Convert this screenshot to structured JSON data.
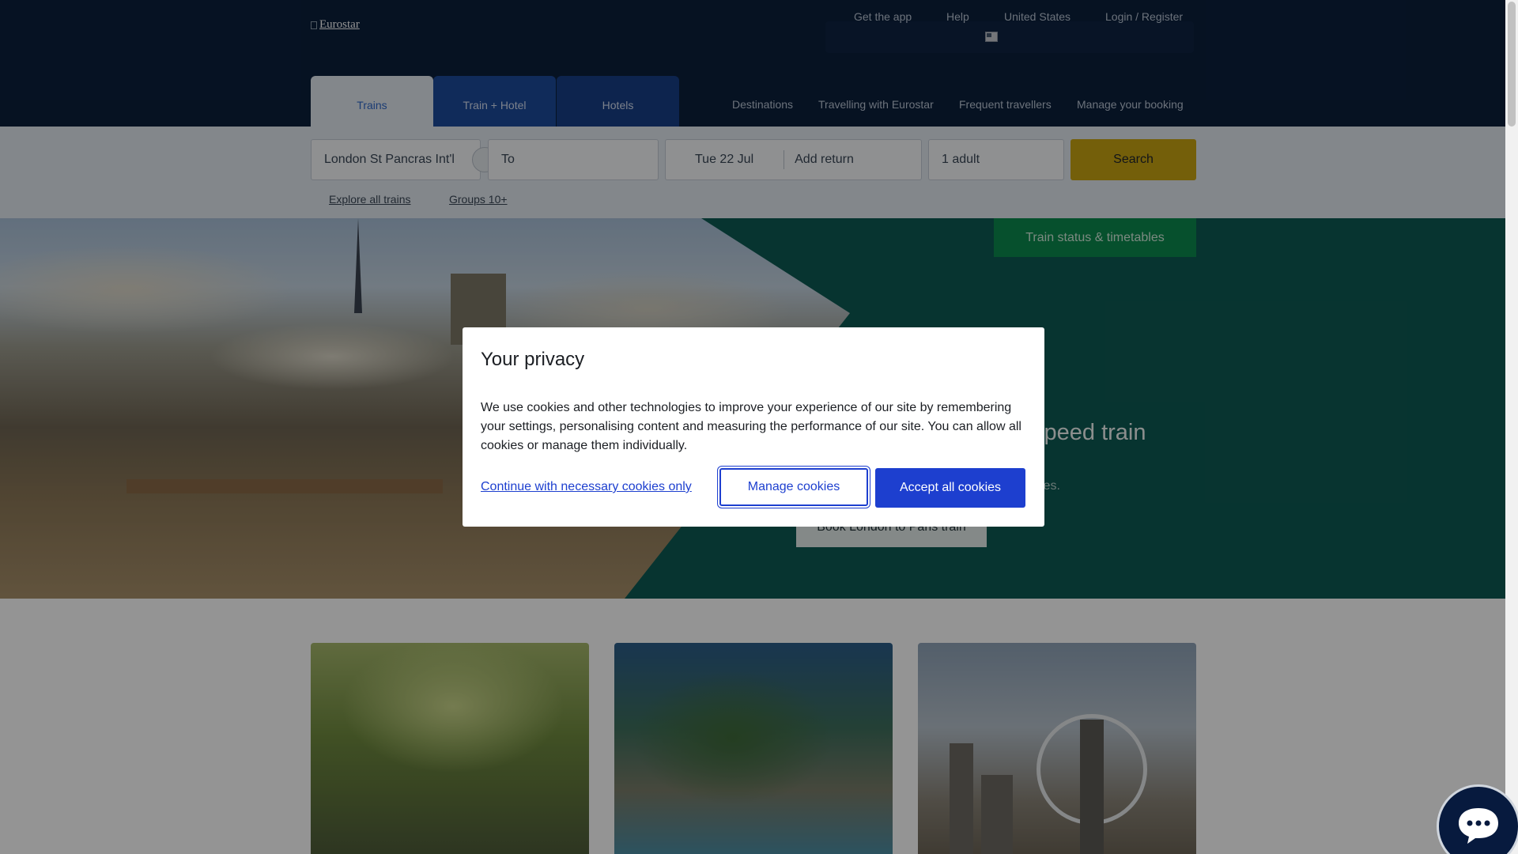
{
  "header": {
    "logo_alt": "Eurostar",
    "utility": {
      "get_app": "Get the app",
      "help": "Help",
      "country": "United States",
      "login": "Login / Register"
    },
    "tabs": [
      {
        "label": "Trains",
        "active": true
      },
      {
        "label": "Train + Hotel",
        "active": false
      },
      {
        "label": "Hotels",
        "active": false
      }
    ],
    "nav": [
      "Destinations",
      "Travelling with Eurostar",
      "Frequent travellers",
      "Manage your booking"
    ]
  },
  "search": {
    "from_value": "London St Pancras Int'l",
    "to_placeholder": "To",
    "date": "Tue 22 Jul",
    "return_placeholder": "Add return",
    "passengers": "1 adult",
    "search_label": "Search",
    "links": [
      "Explore all trains",
      "Groups 10+"
    ]
  },
  "hero": {
    "status_button": "Train status & timetables",
    "headline_partial": "speed train",
    "subtext_partial": "ities.",
    "cta": "Book London to Paris train"
  },
  "cookie_modal": {
    "title": "Your privacy",
    "body": "We use cookies and other technologies to improve your experience of our site by remembering your settings, personalising content and measuring the performance of our site. You can allow all cookies or manage them individually.",
    "necessary_label": "Continue with necessary cookies only",
    "manage_label": "Manage cookies",
    "accept_label": "Accept all cookies"
  },
  "colors": {
    "header_bg": "#0b1f3c",
    "search_band": "#e2e8ef",
    "search_button": "#c9a412",
    "hero_teal": "#0d5a53",
    "status_green": "#0b8a4f",
    "primary_blue": "#1d3fcf"
  },
  "icons": {
    "chat": "chat-bubble-icon",
    "swap": "swap-icon",
    "flag": "flag-icon"
  }
}
